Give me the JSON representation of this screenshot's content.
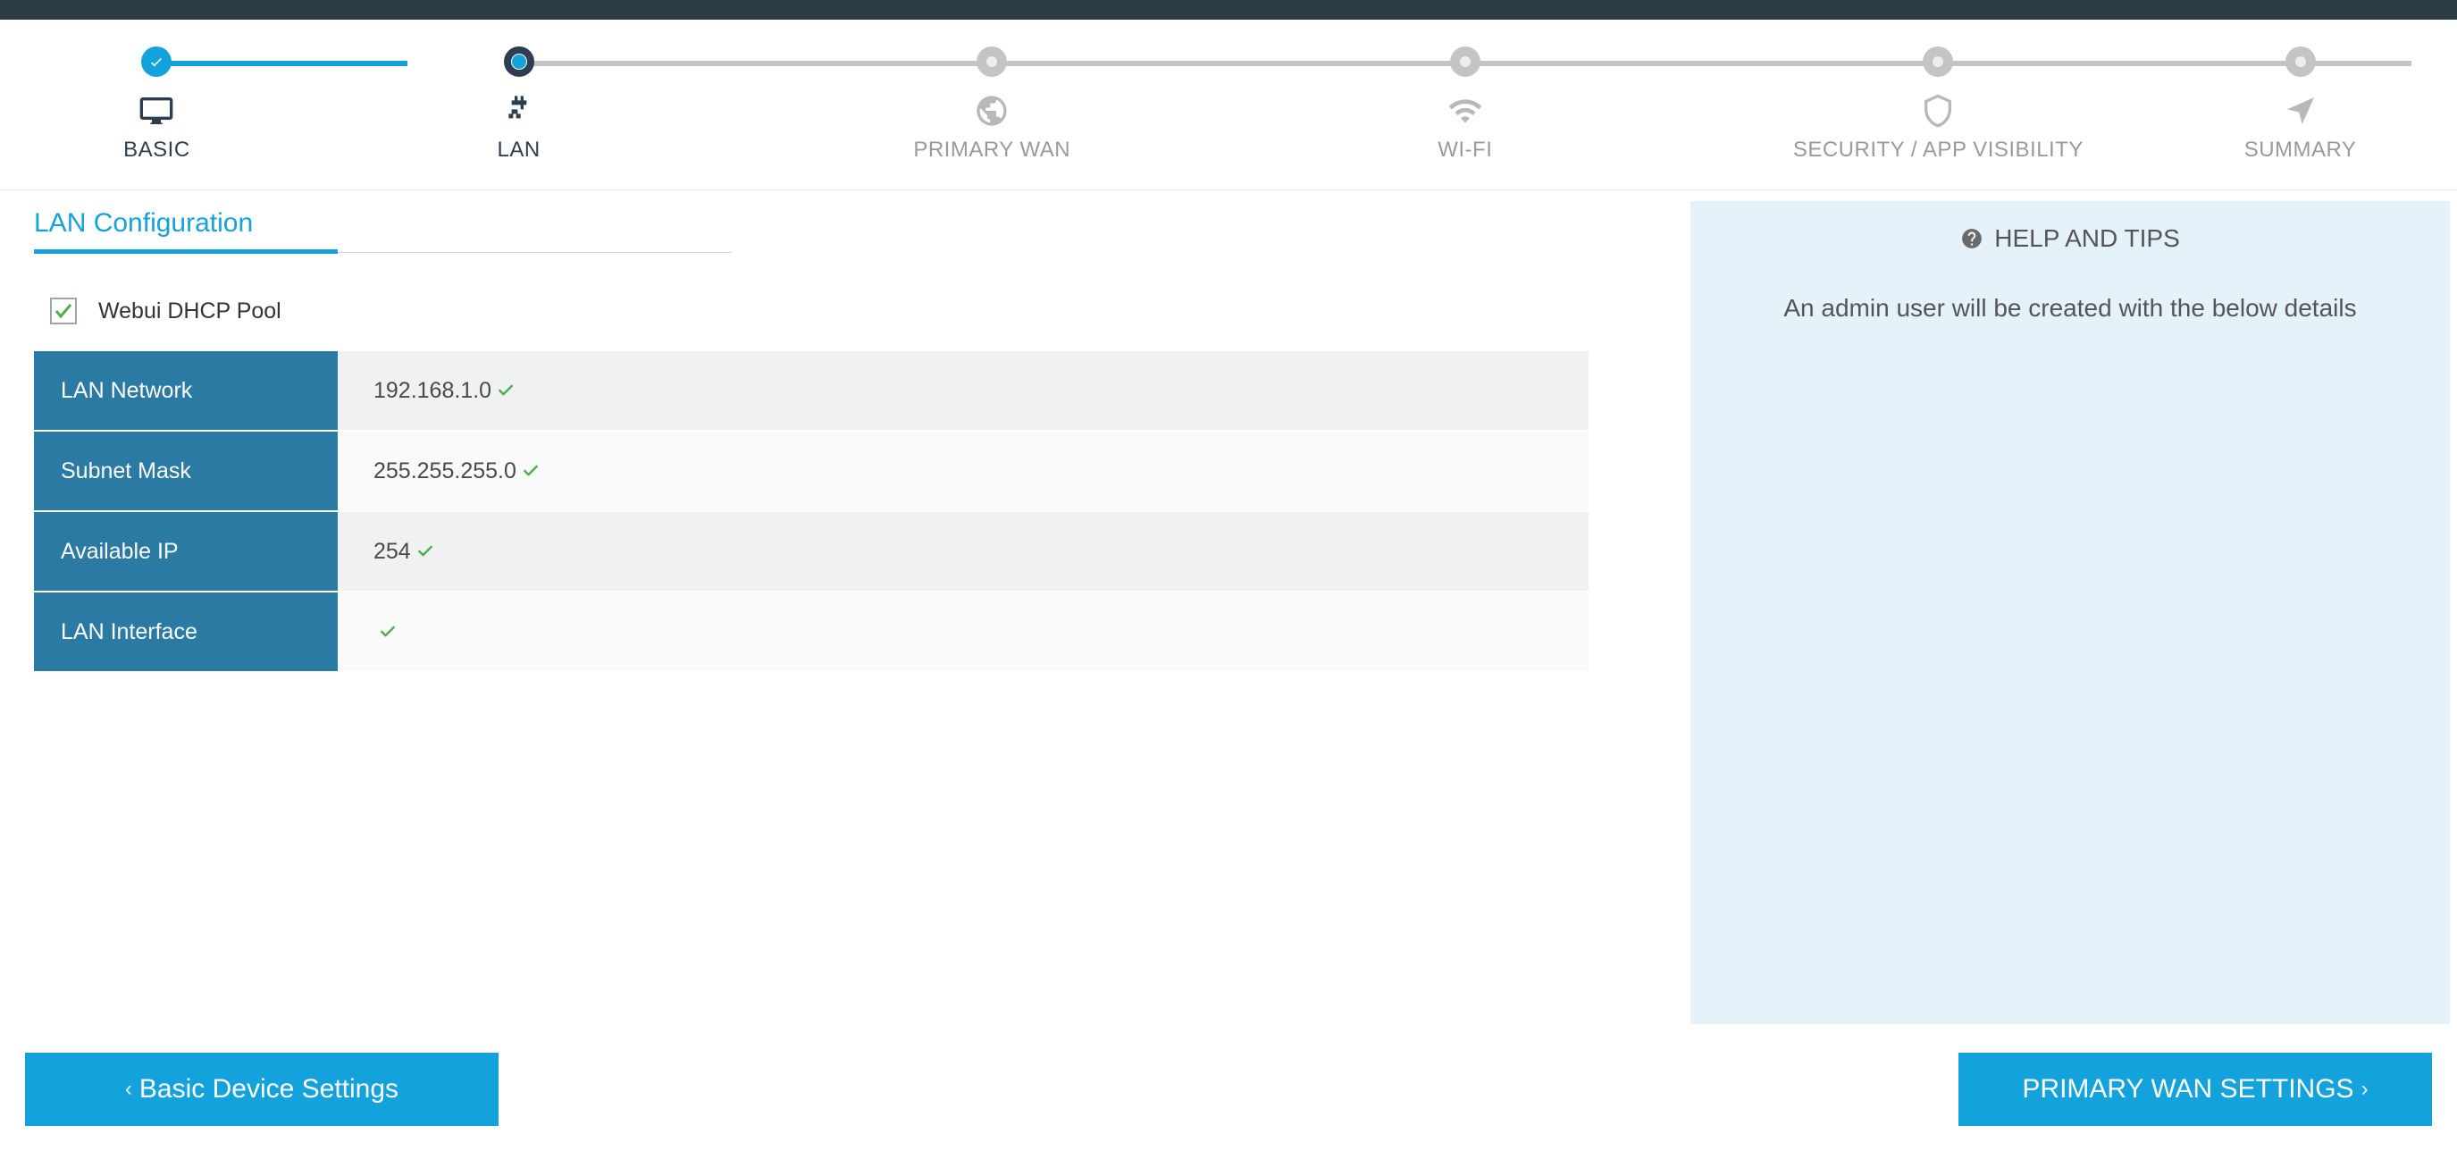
{
  "stepper": {
    "steps": [
      {
        "label": "BASIC",
        "state": "completed"
      },
      {
        "label": "LAN",
        "state": "current"
      },
      {
        "label": "PRIMARY WAN",
        "state": "pending"
      },
      {
        "label": "WI-FI",
        "state": "pending"
      },
      {
        "label": "SECURITY / APP VISIBILITY",
        "state": "pending"
      },
      {
        "label": "SUMMARY",
        "state": "pending"
      }
    ]
  },
  "main": {
    "section_title": "LAN Configuration",
    "checkbox": {
      "label": "Webui DHCP Pool",
      "checked": true
    },
    "rows": [
      {
        "label": "LAN Network",
        "value": "192.168.1.0"
      },
      {
        "label": "Subnet Mask",
        "value": "255.255.255.0"
      },
      {
        "label": "Available IP",
        "value": "254"
      },
      {
        "label": "LAN Interface",
        "value": ""
      }
    ]
  },
  "sidebar": {
    "title": "HELP AND TIPS",
    "body": "An admin user will be created with the below details"
  },
  "footer": {
    "back_label": "Basic Device Settings",
    "next_label": "PRIMARY WAN SETTINGS"
  }
}
